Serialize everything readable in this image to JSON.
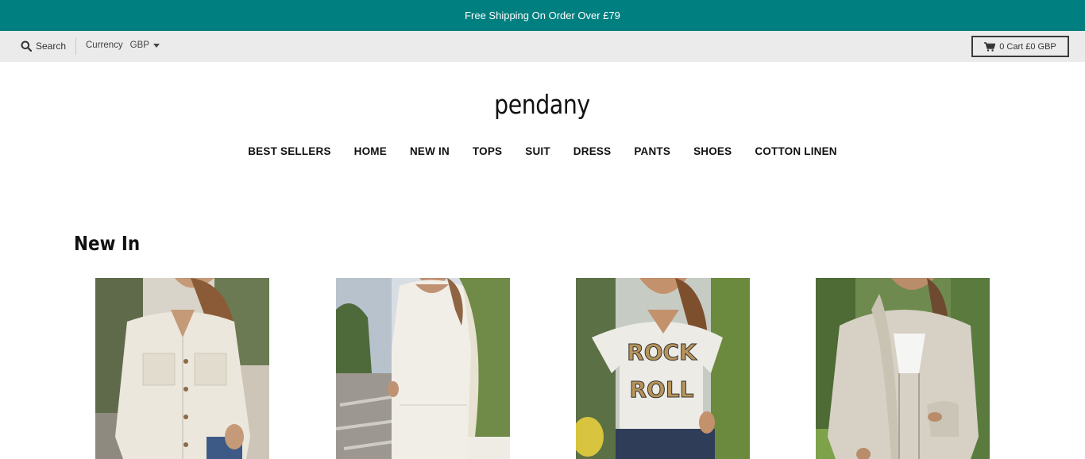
{
  "announcement": "Free Shipping On Order Over £79",
  "topbar": {
    "search_label": "Search",
    "currency_label": "Currency",
    "currency_value": "GBP",
    "cart_label": "0 Cart £0 GBP"
  },
  "logo": "pendany",
  "nav": [
    "BEST SELLERS",
    "HOME",
    "NEW IN",
    "TOPS",
    "SUIT",
    "DRESS",
    "PANTS",
    "SHOES",
    "COTTON LINEN"
  ],
  "section": {
    "title": "New In"
  },
  "products": [
    {
      "image": "linen-button-shirt-photo"
    },
    {
      "image": "white-maxi-dress-photo"
    },
    {
      "image": "rock-roll-tshirt-photo",
      "print_line1": "ROCK",
      "print_line2": "ROLL"
    },
    {
      "image": "beige-hooded-jacket-photo"
    }
  ],
  "colors": {
    "announcement_bg": "#007f80",
    "topbar_bg": "#ebebeb"
  }
}
